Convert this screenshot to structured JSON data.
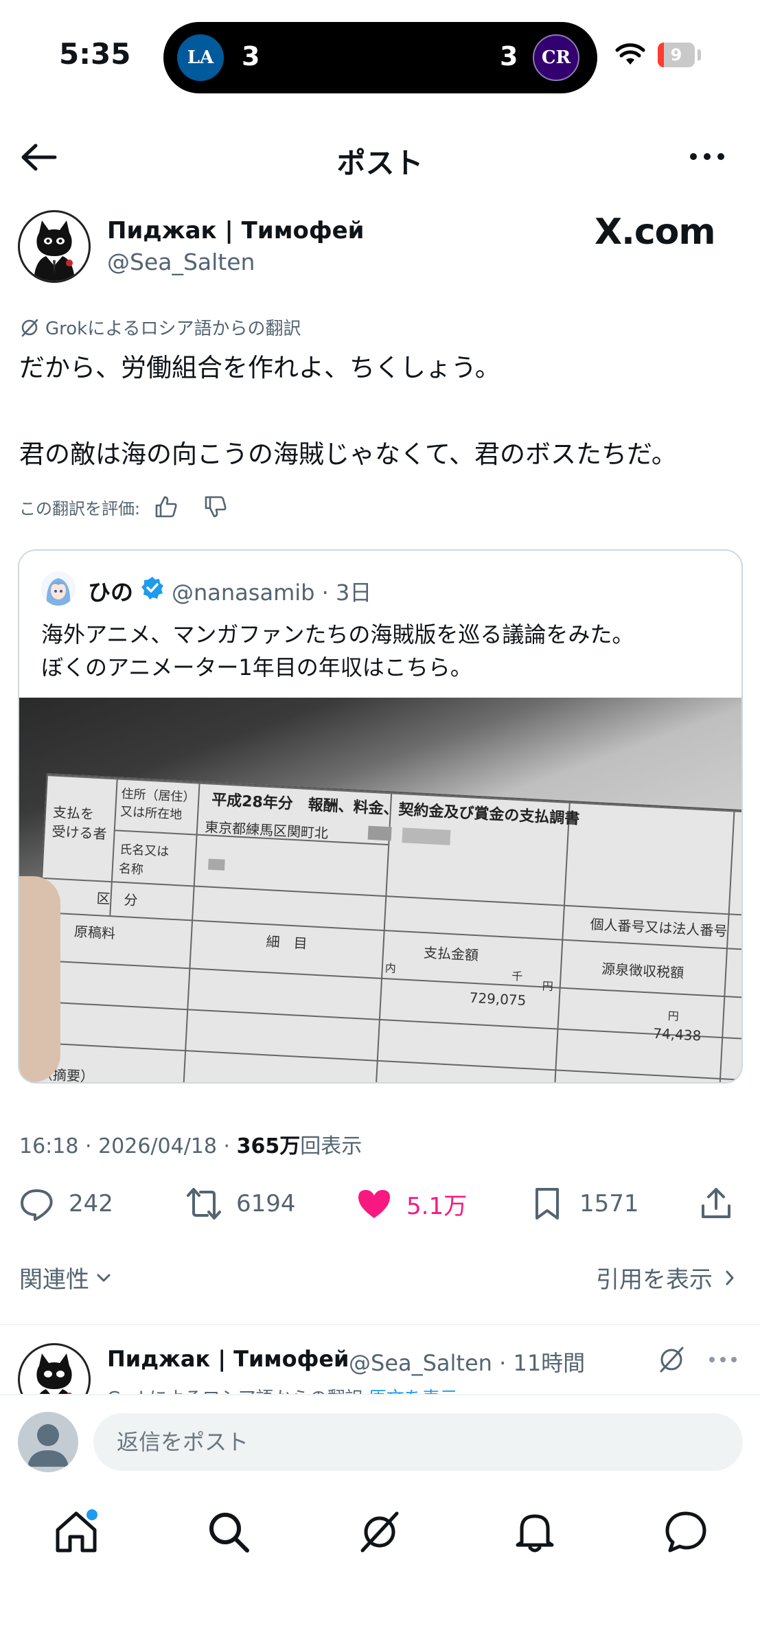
{
  "status_bar": {
    "time": "5:35",
    "team_left_logo": "LA",
    "team_left_score": "3",
    "team_right_logo": "CR",
    "team_right_score": "3",
    "battery": "9"
  },
  "header": {
    "title": "ポスト"
  },
  "post": {
    "author_name": "Пиджак | Тимофей",
    "author_handle": "@Sea_Salten",
    "watermark": "X.com",
    "grok_label": "Grokによるロシア語からの翻訳",
    "text_line1": "だから、労働組合を作れよ、ちくしょう。",
    "text_line2": "君の敵は海の向こうの海賊じゃなくて、君のボスたちだ。",
    "rate_label": "この翻訳を評価:",
    "timestamp": "16:18 · 2026/04/18 · ",
    "views_count": "365万",
    "views_label": "回表示"
  },
  "quote": {
    "name": "ひの",
    "meta": "@nanasamib · 3日",
    "text_line1": "海外アニメ、マンガファンたちの海賊版を巡る議論をみた。",
    "text_line2": "ぼくのアニメーター1年目の年収はこちら。",
    "image_doc": {
      "title": "平成28年分　報酬、料金、契約金及び賞金の支払調書",
      "cell_payee": "支払を\n受ける者",
      "cell_address_label": "住所（居住）\n又は所在地",
      "cell_address": "東京都練馬区関町北",
      "cell_name_label": "氏名又は\n名称",
      "cell_kubun": "区　分",
      "cell_item": "細　目",
      "cell_genkoryo": "原稿料",
      "cell_kojin": "個人番号又は法人番号",
      "cell_shiharai": "支払金額",
      "cell_gensen": "源泉徴収税額",
      "amount": "729,075",
      "tax": "74,438",
      "cell_tekiyo": "（摘要）",
      "yen": "円",
      "sen": "千",
      "uchi": "内"
    }
  },
  "actions": {
    "replies": "242",
    "reposts": "6194",
    "likes": "5.1万",
    "bookmarks": "1571"
  },
  "sort": {
    "left": "関連性",
    "right": "引用を表示"
  },
  "reply": {
    "author_name": "Пиджак | Тимофей",
    "author_meta": "@Sea_Salten · 11時間",
    "sub_label": "Grokによるロシア語からの翻訳",
    "sub_link": "原文を表示"
  },
  "composer": {
    "placeholder": "返信をポスト"
  },
  "colors": {
    "accent": "#1d9bf0",
    "like": "#f91880",
    "secondary_text": "#536471",
    "dodgers": "#005a9c",
    "rockies": "#33006f"
  },
  "icons": [
    "back-arrow-icon",
    "more-icon",
    "grok-icon",
    "thumbs-up-icon",
    "thumbs-down-icon",
    "verified-icon",
    "reply-icon",
    "repost-icon",
    "heart-icon",
    "bookmark-icon",
    "share-icon",
    "chevron-down-icon",
    "chevron-right-icon",
    "home-icon",
    "search-icon",
    "grok-tab-icon",
    "notifications-icon",
    "messages-icon"
  ]
}
